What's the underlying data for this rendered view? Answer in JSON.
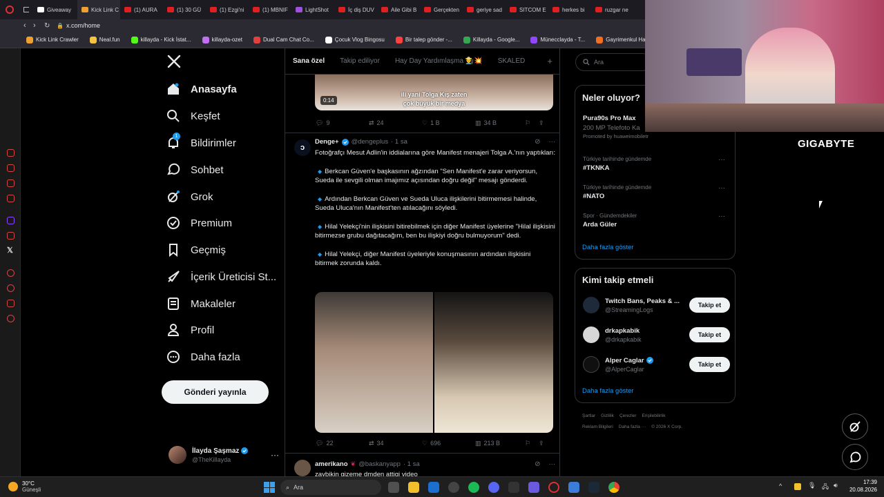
{
  "browser": {
    "tabs": [
      {
        "label": "Giveaway",
        "color": "#ffffff"
      },
      {
        "label": "Kick Link C",
        "color": "#f0a030"
      },
      {
        "label": "(1) AURA",
        "color": "#e02020"
      },
      {
        "label": "(1) 30 GÜ",
        "color": "#e02020"
      },
      {
        "label": "(1) Ezgi'ni",
        "color": "#e02020"
      },
      {
        "label": "(1) MBNIF",
        "color": "#e02020"
      },
      {
        "label": "LightShot",
        "color": "#a050e0"
      },
      {
        "label": "İç diş DUV",
        "color": "#e02020"
      },
      {
        "label": "Aile Gibi B",
        "color": "#e02020"
      },
      {
        "label": "Gerçekten",
        "color": "#e02020"
      },
      {
        "label": "geriye sad",
        "color": "#e02020"
      },
      {
        "label": "SITCOM E",
        "color": "#e02020"
      },
      {
        "label": "herkes bi",
        "color": "#e02020"
      },
      {
        "label": "ruzgar ne",
        "color": "#e02020"
      }
    ],
    "url": "x.com/home",
    "bookmarks": [
      {
        "label": "Kick Link Crawler",
        "color": "#f0a030"
      },
      {
        "label": "Neal.fun",
        "color": "#f5c542"
      },
      {
        "label": "killayda - Kick İstat...",
        "color": "#53fc18"
      },
      {
        "label": "killayda-ozet",
        "color": "#c070f0"
      },
      {
        "label": "Dual Cam Chat Co...",
        "color": "#e04040"
      },
      {
        "label": "Çocuk Vlog Bingosu",
        "color": "#ffffff"
      },
      {
        "label": "Bir talep gönder -...",
        "color": "#ff4040"
      },
      {
        "label": "Killayda - Google...",
        "color": "#34a853"
      },
      {
        "label": "Münecclayda - T...",
        "color": "#9146ff"
      },
      {
        "label": "Gayrimenkul Ha...",
        "color": "#f07020"
      }
    ]
  },
  "nav": {
    "home": "Anasayfa",
    "explore": "Keşfet",
    "notifications": "Bildirimler",
    "notif_count": "1",
    "chat": "Sohbet",
    "grok": "Grok",
    "premium": "Premium",
    "history": "Geçmiş",
    "creator": "İçerik Üreticisi St...",
    "articles": "Makaleler",
    "profile": "Profil",
    "more": "Daha fazla",
    "post_button": "Gönderi yayınla"
  },
  "account": {
    "name": "İlayda Şaşmaz",
    "handle": "@TheKillayda"
  },
  "timeline": {
    "tabs": [
      "Sana özel",
      "Takip ediliyor",
      "Hay Day Yardımlaşma 👨‍🌾💥",
      "SKALED"
    ],
    "video": {
      "duration": "0:14",
      "subtitle1": "ili yani Tolga Kış zaten",
      "subtitle2": "çok büyük bir medya"
    },
    "post0_stats": {
      "replies": "9",
      "reposts": "24",
      "likes": "1 B",
      "views": "34 B"
    },
    "post1": {
      "name": "Denge+",
      "handle": "@dengeplus",
      "time": "· 1 sa",
      "intro": "Fotoğrafçı Mesut Adlin'in iddialarına göre Manifest menajeri Tolga A.'nın yaptıkları:",
      "bullets": [
        "Berkcan Güven'e başkasının ağzından \"Sen Manifest'e zarar veriyorsun, Sueda ile sevgili olman imajımız açısından doğru değil\" mesajı gönderdi.",
        "Ardından Berkcan Güven ve Sueda Uluca ilişkilerini bitirmemesi halinde, Sueda Uluca'nın Manifest'ten atılacağını söyledi.",
        "Hilal Yelekçi'nin ilişkisini bitirebilmek için diğer Manifest üyelerine \"Hilal ilişkisini bitirmezse grubu dağıtacağım, ben bu ilişkiyi doğru bulmuyorum\" dedi.",
        "Hilal Yelekçi, diğer Manifest üyeleriyle konuşmasının ardından ilişkisini bitirmek zorunda kaldı."
      ],
      "stats": {
        "replies": "22",
        "reposts": "34",
        "likes": "696",
        "views": "213 B"
      }
    },
    "post2": {
      "name": "amerikano",
      "handle": "@baskanyapp",
      "time": "· 1 sa",
      "text": "zaybikin gizeme dmden attigi video"
    }
  },
  "right": {
    "search_placeholder": "Ara",
    "whats_happening": "Neler oluyor?",
    "ad": {
      "title": "Pura90s Pro Max",
      "sub": "200 MP Telefoto Ka",
      "promo": "Promoted by huaweimobiletr"
    },
    "trends": [
      {
        "meta": "Türkiye tarihinde gündemde",
        "name": "#TKNKA"
      },
      {
        "meta": "Türkiye tarihinde gündemde",
        "name": "#NATO"
      },
      {
        "meta": "Spor · Gündemdekiler",
        "name": "Arda Güler"
      }
    ],
    "show_more": "Daha fazla göster",
    "who_to_follow": "Kimi takip etmeli",
    "follow_label": "Takip et",
    "suggestions": [
      {
        "name": "Twitch Bans, Peaks & ...",
        "handle": "@StreamingLogs",
        "color": "#1e2a3a"
      },
      {
        "name": "drkapkabik",
        "handle": "@drkapkabik",
        "color": "#d6d6d6"
      },
      {
        "name": "Alper Caglar",
        "handle": "@AlperCaglar",
        "color": "#101010"
      }
    ],
    "footer1": [
      "Şartlar",
      "Gizlilik",
      "Çerezler",
      "Erişilebilirlik"
    ],
    "footer2": [
      "Reklam Bilgileri",
      "Daha fazla ···",
      "© 2026 X Corp."
    ]
  },
  "overlay": {
    "brand": "GIGABYTE"
  },
  "taskbar": {
    "temp": "30°C",
    "weather": "Güneşli",
    "search": "Ara",
    "time": "17:39",
    "date": "20.08.2026"
  }
}
